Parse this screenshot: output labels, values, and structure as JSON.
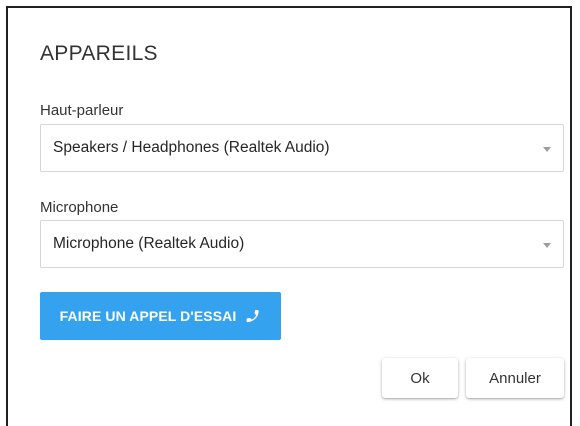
{
  "dialog": {
    "title": "APPAREILS",
    "speaker": {
      "label": "Haut-parleur",
      "selected": "Speakers / Headphones (Realtek Audio)"
    },
    "microphone": {
      "label": "Microphone",
      "selected": "Microphone (Realtek Audio)"
    },
    "test_call": {
      "label": "FAIRE UN APPEL D'ESSAI",
      "icon": "phone-icon"
    },
    "buttons": {
      "ok": "Ok",
      "cancel": "Annuler"
    }
  },
  "colors": {
    "accent": "#35a2f0",
    "border": "#d6d6d6",
    "text": "#333333"
  }
}
